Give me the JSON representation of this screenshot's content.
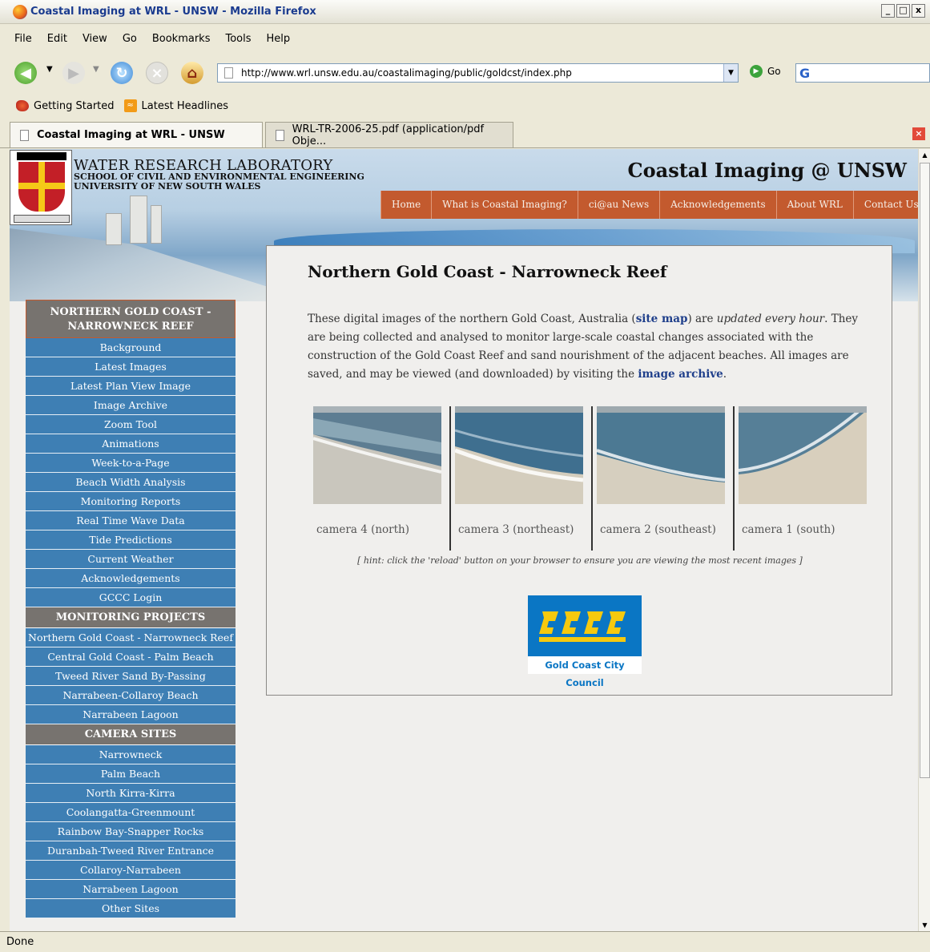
{
  "window": {
    "title": "Coastal Imaging at WRL - UNSW - Mozilla Firefox",
    "buttons": [
      "_",
      "□",
      "x"
    ]
  },
  "menu": [
    "File",
    "Edit",
    "View",
    "Go",
    "Bookmarks",
    "Tools",
    "Help"
  ],
  "toolbar": {
    "url": "http://www.wrl.unsw.edu.au/coastalimaging/public/goldcst/index.php",
    "go_label": "Go"
  },
  "bookmarks": [
    "Getting Started",
    "Latest Headlines"
  ],
  "tabs": [
    {
      "label": "Coastal Imaging at WRL - UNSW",
      "active": true
    },
    {
      "label": "WRL-TR-2006-25.pdf (application/pdf Obje...",
      "active": false
    }
  ],
  "status": "Done",
  "header": {
    "org_line1": "WATER RESEARCH LABORATORY",
    "org_line2": "SCHOOL OF CIVIL AND ENVIRONMENTAL ENGINEERING",
    "org_line3": "UNIVERSITY OF NEW SOUTH WALES",
    "site_title": "Coastal Imaging @ UNSW",
    "nav": [
      "Home",
      "What is Coastal Imaging?",
      "ci@au News",
      "Acknowledgements",
      "About WRL",
      "Contact Us"
    ]
  },
  "sidebar": {
    "section1_title": "NORTHERN GOLD COAST - NARROWNECK REEF",
    "section1_items": [
      "Background",
      "Latest Images",
      "Latest Plan View Image",
      "Image Archive",
      "Zoom Tool",
      "Animations",
      "Week-to-a-Page",
      "Beach Width Analysis",
      "Monitoring Reports",
      "Real Time Wave Data",
      "Tide Predictions",
      "Current Weather",
      "Acknowledgements",
      "GCCC Login"
    ],
    "section2_title": "MONITORING PROJECTS",
    "section2_items": [
      "Northern Gold Coast - Narrowneck Reef",
      "Central Gold Coast - Palm Beach",
      "Tweed River Sand By-Passing",
      "Narrabeen-Collaroy Beach",
      "Narrabeen Lagoon"
    ],
    "section3_title": "CAMERA SITES",
    "section3_items": [
      "Narrowneck",
      "Palm Beach",
      "North Kirra-Kirra",
      "Coolangatta-Greenmount",
      "Rainbow Bay-Snapper Rocks",
      "Duranbah-Tweed River Entrance",
      "Collaroy-Narrabeen",
      "Narrabeen Lagoon",
      "Other Sites"
    ]
  },
  "main": {
    "heading": "Northern Gold Coast - Narrowneck Reef",
    "intro_part1": "These digital images of the northern Gold Coast, Australia (",
    "site_map_link": "site map",
    "intro_part2": ") are ",
    "intro_italic": "updated every hour",
    "intro_part3": ".  They are being collected and analysed to monitor large-scale coastal changes associated with the construction of the Gold Coast Reef and sand nourishment of the adjacent beaches.  All images are saved, and may be viewed (and downloaded) by visiting the ",
    "archive_link": "image archive",
    "intro_end": ".",
    "cameras": [
      "camera 4 (north)",
      "camera 3  (northeast)",
      "camera 2 (southeast)",
      "camera 1 (south)"
    ],
    "hint": "[ hint: click the 'reload' button on your browser to ensure you are viewing the most recent images ]",
    "logo_text": "Gold Coast City Council"
  }
}
